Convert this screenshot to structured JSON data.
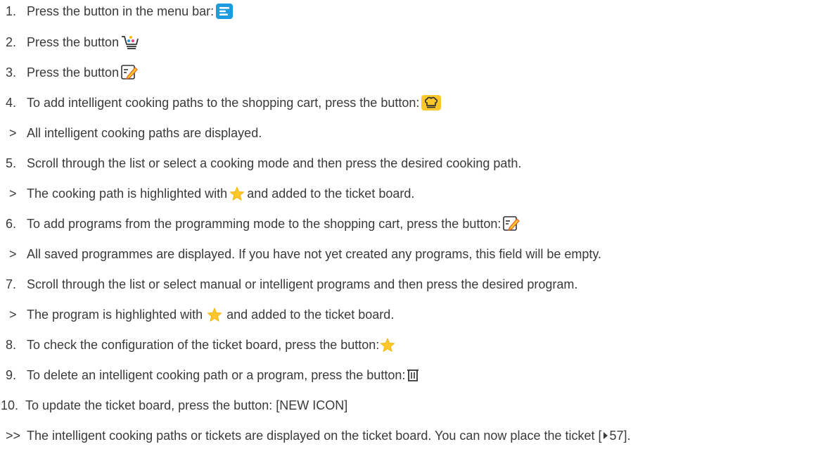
{
  "steps": [
    {
      "marker": "1.",
      "parts": [
        "Press the button in the menu bar:"
      ],
      "icon": "menu-icon"
    },
    {
      "marker": "2.",
      "parts": [
        "Press the button"
      ],
      "icon": "shopping-cart-icon"
    },
    {
      "marker": "3.",
      "parts": [
        "Press the button"
      ],
      "icon": "edit-program-icon"
    },
    {
      "marker": "4.",
      "parts": [
        "To add intelligent cooking paths to the shopping cart, press the button:"
      ],
      "icon": "chef-hat-icon"
    },
    {
      "marker": ">",
      "parts": [
        "All intelligent cooking paths are displayed."
      ]
    },
    {
      "marker": "5.",
      "parts": [
        "Scroll through the list or select a cooking mode and then press the desired cooking path."
      ]
    },
    {
      "marker": ">",
      "parts": [
        "The cooking path is highlighted with",
        "and added to the ticket board."
      ],
      "icon": "star-icon"
    },
    {
      "marker": "6.",
      "parts": [
        "To add programs from the programming mode to the shopping cart, press the button:"
      ],
      "icon": "edit-program-icon"
    },
    {
      "marker": ">",
      "parts": [
        "All saved programmes are displayed. If you have not yet created any programs, this field will be empty."
      ]
    },
    {
      "marker": "7.",
      "parts": [
        "Scroll through the list or select manual or intelligent programs and then press the desired program."
      ]
    },
    {
      "marker": ">",
      "parts": [
        "The program is highlighted with",
        "and added to the ticket board."
      ],
      "icon": "star-icon"
    },
    {
      "marker": "8.",
      "parts": [
        "To check the configuration of the ticket board, press the button:"
      ],
      "icon": "star-icon"
    },
    {
      "marker": "9.",
      "parts": [
        "To delete an intelligent cooking path or a program, press the button:"
      ],
      "icon": "trash-icon"
    },
    {
      "marker": "10.",
      "parts": [
        "To update the ticket board, press the button: [NEW ICON]"
      ]
    },
    {
      "marker": ">>",
      "parts": [
        "The intelligent cooking paths or tickets are displayed on the ticket board. You can now place the ticket [",
        "57]."
      ],
      "icon": "play-arrow-icon"
    }
  ],
  "colors": {
    "text": "#3a3a3a",
    "menu_blue": "#1e9be0",
    "chef_yellow": "#ffc72c",
    "star_yellow": "#ffc72c",
    "cart_yellow": "#f5b800",
    "cart_blue": "#1e9be0"
  }
}
